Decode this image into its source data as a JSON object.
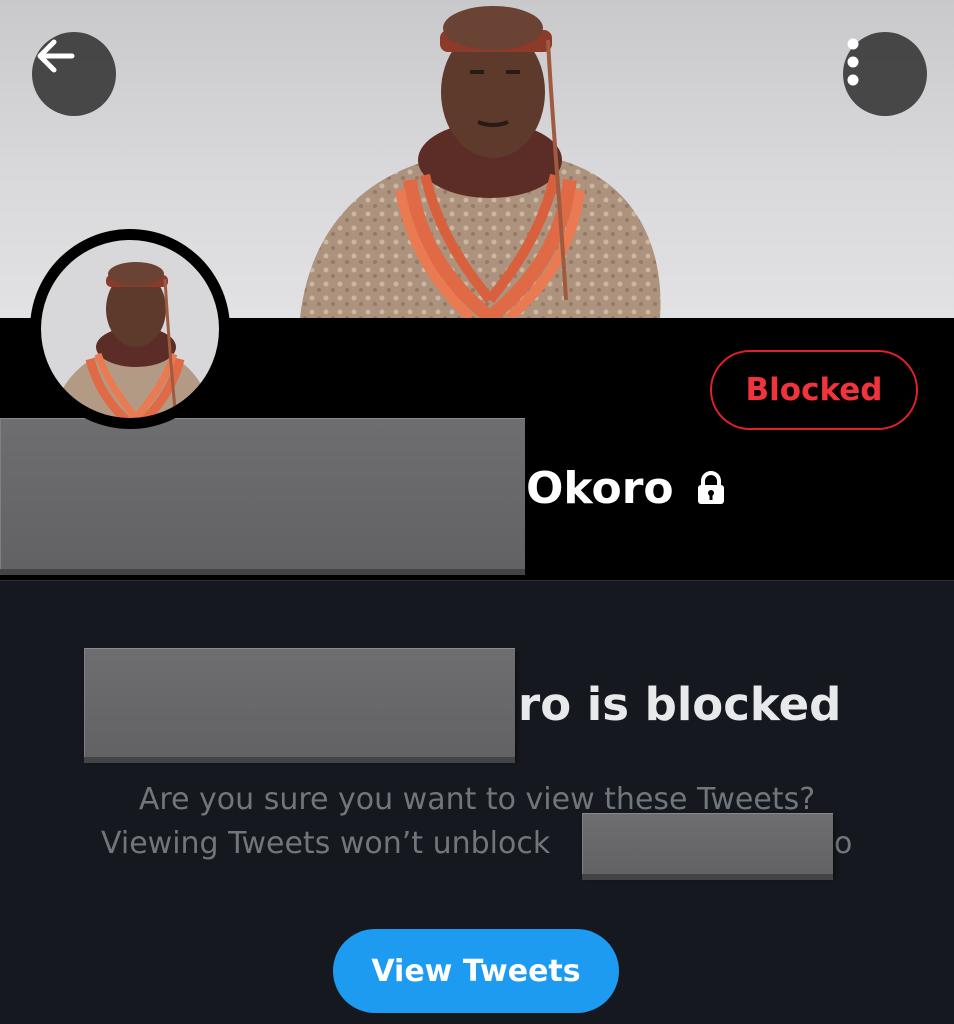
{
  "profile": {
    "name_visible": "Okoro",
    "blocked_label": "Blocked"
  },
  "blocked_notice": {
    "title_visible": "ro is blocked",
    "line1": "Are you sure you want to view these Tweets?",
    "line2_visible": "Viewing Tweets won’t unblock",
    "line2_tail": "o",
    "button_label": "View Tweets"
  },
  "icons": {
    "back": "arrow-left-icon",
    "more": "more-vertical-icon",
    "lock": "lock-icon"
  },
  "colors": {
    "accent_blue": "#1d9bf0",
    "blocked_red": "#f0333c",
    "background_dark": "#15181e"
  }
}
